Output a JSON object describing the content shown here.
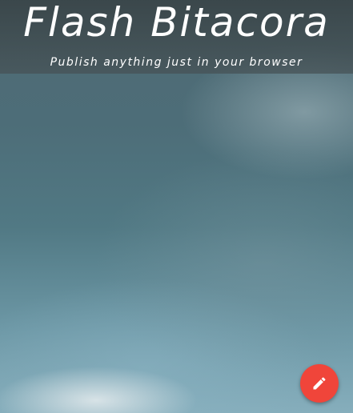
{
  "header": {
    "title": "Flash Bitacora",
    "subtitle": "Publish anything just in your browser"
  },
  "fab": {
    "icon": "pencil-icon",
    "color": "#f0453a"
  }
}
